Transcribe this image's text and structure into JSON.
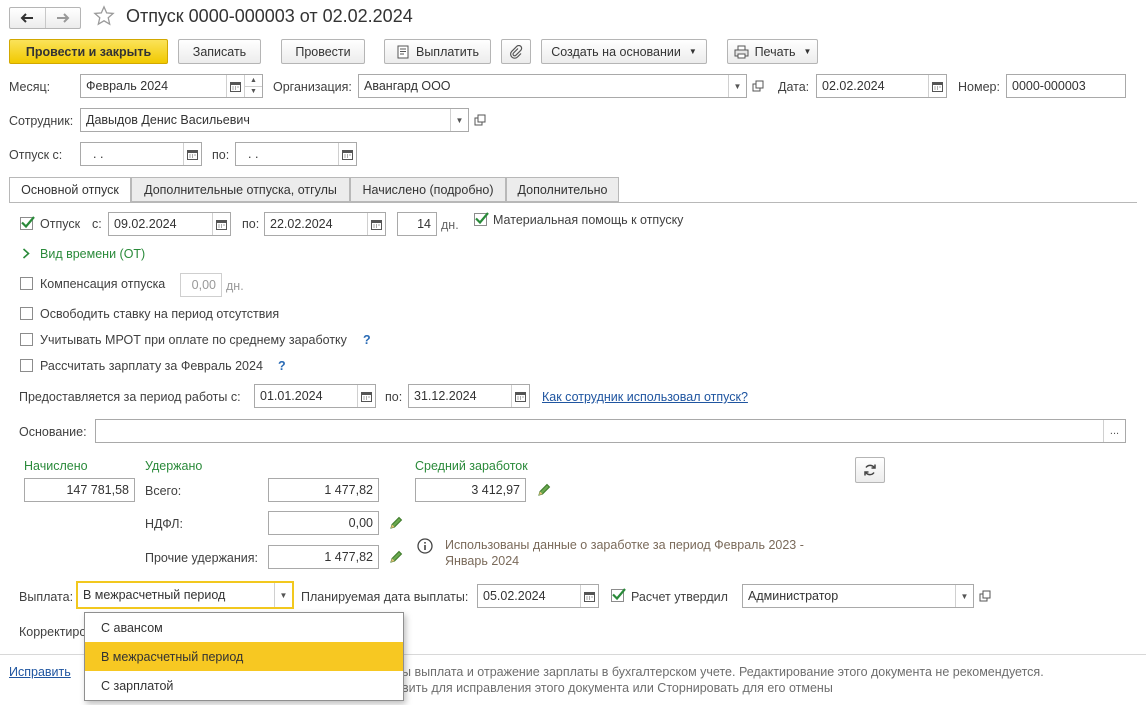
{
  "window": {
    "title": "Отпуск 0000-000003 от 02.02.2024"
  },
  "toolbar": {
    "post_close": "Провести и закрыть",
    "save": "Записать",
    "post": "Провести",
    "pay": "Выплатить",
    "create_based": "Создать на основании",
    "print": "Печать"
  },
  "header": {
    "month_label": "Месяц:",
    "month_value": "Февраль 2024",
    "org_label": "Организация:",
    "org_value": "Авангард ООО",
    "date_label": "Дата:",
    "date_value": "02.02.2024",
    "number_label": "Номер:",
    "number_value": "0000-000003",
    "employee_label": "Сотрудник:",
    "employee_value": "Давыдов Денис Васильевич",
    "vacation_from_label": "Отпуск с:",
    "vacation_from_value": " .  .",
    "vacation_to_label": "по:",
    "vacation_to_value": " .  ."
  },
  "tabs": [
    {
      "label": "Основной отпуск",
      "active": true
    },
    {
      "label": "Дополнительные отпуска, отгулы",
      "active": false
    },
    {
      "label": "Начислено (подробно)",
      "active": false
    },
    {
      "label": "Дополнительно",
      "active": false
    }
  ],
  "main": {
    "vacation_checkbox_label": "Отпуск",
    "vacation_checked": true,
    "from_label": "с:",
    "from_value": "09.02.2024",
    "to_label": "по:",
    "to_value": "22.02.2024",
    "days_value": "14",
    "days_unit": "дн.",
    "material_help_label": "Материальная помощь к отпуску",
    "material_help_checked": true,
    "time_kind_label": "Вид времени (ОТ)",
    "compensation_label": "Компенсация отпуска",
    "compensation_value": "0,00",
    "compensation_unit": "дн.",
    "free_rate_label": "Освободить ставку на период отсутствия",
    "mrot_label": "Учитывать МРОТ при оплате по среднему заработку",
    "calc_salary_label": "Рассчитать зарплату за Февраль 2024",
    "qmark": "?",
    "period_label": "Предоставляется за период работы с:",
    "period_from": "01.01.2024",
    "period_to_label": "по:",
    "period_to": "31.12.2024",
    "usage_link": "Как сотрудник использовал отпуск?",
    "basis_label": "Основание:",
    "basis_value": "",
    "basis_button": "..."
  },
  "totals": {
    "accrued_title": "Начислено",
    "accrued_value": "147 781,58",
    "withheld_title": "Удержано",
    "total_label": "Всего:",
    "total_value": "1 477,82",
    "ndfl_label": "НДФЛ:",
    "ndfl_value": "0,00",
    "other_label": "Прочие удержания:",
    "other_value": "1 477,82",
    "avg_title": "Средний заработок",
    "avg_value": "3 412,97",
    "info_line1": "Использованы данные о заработке за период Февраль 2023 -",
    "info_line2": "Январь 2024"
  },
  "payment": {
    "label": "Выплата:",
    "value": "В межрасчетный период",
    "planned_label": "Планируемая дата выплаты:",
    "planned_value": "05.02.2024",
    "approved_label": "Расчет утвердил",
    "approved_checked": true,
    "approver_value": "Администратор",
    "correction_label": "Корректиро",
    "options": [
      {
        "label": "С авансом",
        "selected": false
      },
      {
        "label": "В межрасчетный период",
        "selected": true
      },
      {
        "label": "С зарплатой",
        "selected": false
      }
    ]
  },
  "footer": {
    "fix_link": "Исправить",
    "line1": "ы выплата и отражение зарплаты в бухгалтерском учете. Редактирование этого документа не рекомендуется.",
    "line2": "вить для исправления этого документа или Сторнировать для его отмены"
  },
  "colors": {
    "primary_button": "#f5d11a",
    "selected_option": "#f7c822",
    "green_text": "#2a8a3a",
    "link": "#1f55a0"
  }
}
